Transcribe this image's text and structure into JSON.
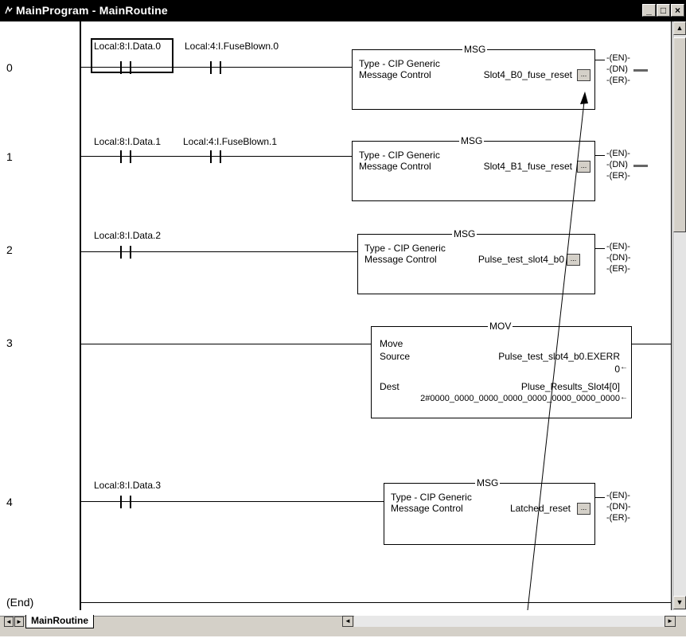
{
  "window": {
    "title": "MainProgram - MainRoutine",
    "min": "_",
    "max": "□",
    "close": "×"
  },
  "rungs": [
    {
      "number": "0",
      "contacts": [
        "Local:8:I.Data.0",
        "Local:4:I.FuseBlown.0"
      ],
      "instr": "MSG",
      "line1": "Type - CIP Generic",
      "line2": "Message Control",
      "control": "Slot4_B0_fuse_reset"
    },
    {
      "number": "1",
      "contacts": [
        "Local:8:I.Data.1",
        "Local:4:I.FuseBlown.1"
      ],
      "instr": "MSG",
      "line1": "Type - CIP Generic",
      "line2": "Message Control",
      "control": "Slot4_B1_fuse_reset"
    },
    {
      "number": "2",
      "contacts": [
        "Local:8:I.Data.2"
      ],
      "instr": "MSG",
      "line1": "Type - CIP Generic",
      "line2": "Message Control",
      "control": "Pulse_test_slot4_b0"
    },
    {
      "number": "3",
      "instr": "MOV",
      "move": "Move",
      "source_label": "Source",
      "source_tag": "Pulse_test_slot4_b0.EXERR",
      "source_value": "0",
      "dest_label": "Dest",
      "dest_tag": "Pluse_Results_Slot4[0]",
      "dest_value": "2#0000_0000_0000_0000_0000_0000_0000_0000"
    },
    {
      "number": "4",
      "contacts": [
        "Local:8:I.Data.3"
      ],
      "instr": "MSG",
      "line1": "Type - CIP Generic",
      "line2": "Message Control",
      "control": "Latched_reset"
    }
  ],
  "end_label": "(End)",
  "outputs": {
    "en": "EN",
    "dn": "DN",
    "er": "ER"
  },
  "edit_button": "...",
  "tab": "MainRoutine",
  "colors": {
    "title_bg": "#000000",
    "face": "#d4d0c8"
  }
}
